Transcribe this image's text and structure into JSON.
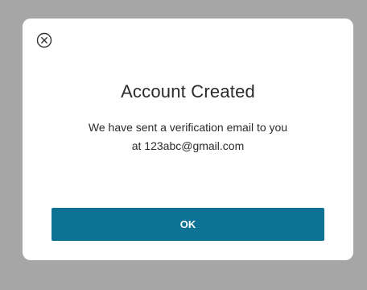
{
  "dialog": {
    "close_icon": "close-circle-icon",
    "title": "Account Created",
    "message_line1": "We have sent a verification email to you",
    "message_line2": "at 123abc@gmail.com",
    "ok_label": "OK"
  },
  "colors": {
    "backdrop": "#a6a6a6",
    "dialog_background": "#ffffff",
    "button_background": "#0d7294",
    "button_text": "#ffffff",
    "text": "#2b2b2b"
  }
}
